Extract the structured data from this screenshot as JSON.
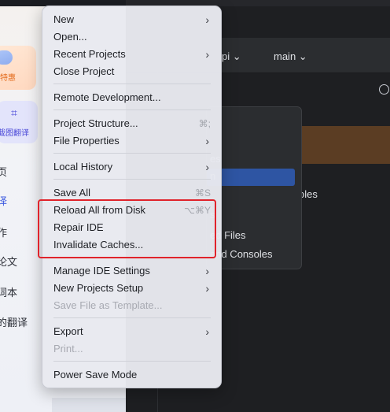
{
  "left_app": {
    "promo_text": "特惠",
    "crop_label": "截图翻译",
    "nav_items": [
      "页",
      "译",
      "作",
      "论文",
      "词本",
      "的翻译"
    ]
  },
  "ide": {
    "project": "pi",
    "branch": "main",
    "submenu_items": [
      "es",
      "n",
      "oles",
      "s",
      "ed Files",
      "and Consoles"
    ]
  },
  "menu": {
    "new": "New",
    "open": "Open...",
    "recent_projects": "Recent Projects",
    "close_project": "Close Project",
    "remote_development": "Remote Development...",
    "project_structure": "Project Structure...",
    "project_structure_shortcut": "⌘;",
    "file_properties": "File Properties",
    "local_history": "Local History",
    "save_all": "Save All",
    "save_all_shortcut": "⌘S",
    "reload_all": "Reload All from Disk",
    "reload_all_shortcut": "⌥⌘Y",
    "repair_ide": "Repair IDE",
    "invalidate_caches": "Invalidate Caches...",
    "manage_ide_settings": "Manage IDE Settings",
    "new_projects_setup": "New Projects Setup",
    "save_as_template": "Save File as Template...",
    "export": "Export",
    "print": "Print...",
    "power_save_mode": "Power Save Mode"
  },
  "colors": {
    "highlight_box": "#e0232b",
    "menu_background": "#e8e9ef",
    "ide_background": "#1e1f22"
  }
}
